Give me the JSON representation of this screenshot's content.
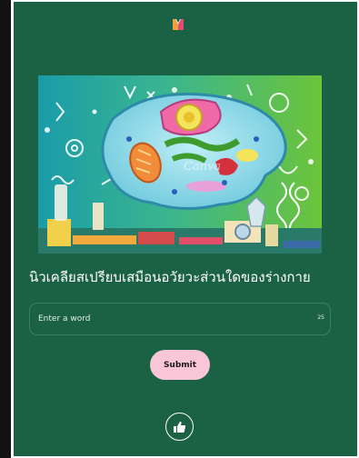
{
  "app": {
    "logo_icon": "m-logo-icon",
    "colors": {
      "background": "#1b6245",
      "submit_button": "#f8c6d7",
      "outer_left_bar": "#121212"
    }
  },
  "illustration": {
    "icon": "animal-cell-illustration",
    "label": "Canva"
  },
  "question": {
    "text": "นิวเคลียสเปรียบเสมือนอวัยวะส่วนใดของร่างกาย"
  },
  "answer_input": {
    "placeholder": "Enter a word",
    "value": "",
    "char_limit": "25"
  },
  "submit": {
    "label": "Submit"
  },
  "like": {
    "icon": "thumbs-up-icon"
  }
}
